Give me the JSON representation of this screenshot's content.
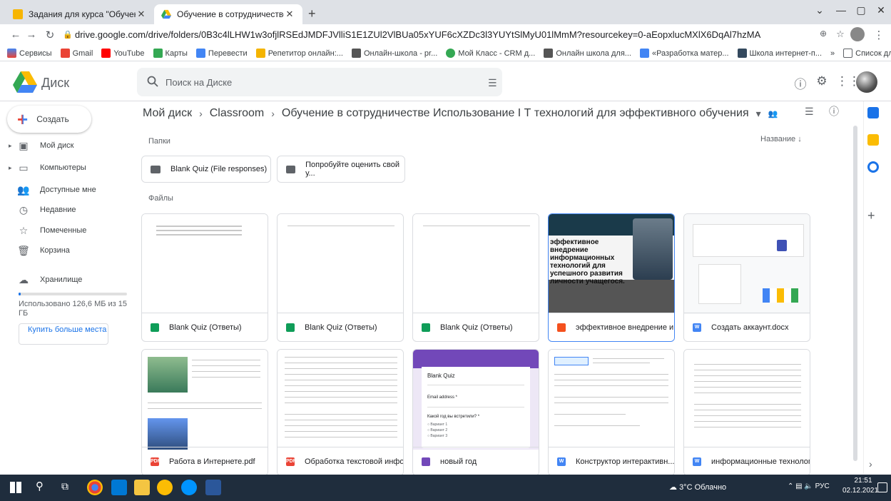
{
  "browser": {
    "tabs": [
      {
        "label": "Задания для курса \"Обучение и"
      },
      {
        "label": "Обучение в сотрудничестве Ис"
      }
    ],
    "url": "drive.google.com/drive/folders/0B3c4lLHW1w3ofjlRSEdJMDFJVlliS1E1ZUl2VlBUa05xYUF6cXZDc3l3YUYtSlMyU01lMmM?resourcekey=0-aEopxlucMXlX6DqAl7hzMA",
    "bookmarks": [
      "Сервисы",
      "Gmail",
      "YouTube",
      "Карты",
      "Перевести",
      "Репетитор онлайн:...",
      "Онлайн-школа - pr...",
      "Мой Класс - CRM д...",
      "Онлайн школа для...",
      "«Разработка матер...",
      "Школа интернет-п..."
    ],
    "reading_list": "Список для чтения"
  },
  "header": {
    "app_title": "Диск",
    "search_placeholder": "Поиск на Диске"
  },
  "sidebar": {
    "create_label": "Создать",
    "items": [
      {
        "label": "Мой диск",
        "icon": "drive-icon",
        "chev": "▸"
      },
      {
        "label": "Компьютеры",
        "icon": "computer-icon",
        "chev": "▸"
      },
      {
        "label": "Доступные мне",
        "icon": "shared-icon",
        "chev": ""
      },
      {
        "label": "Недавние",
        "icon": "clock-icon",
        "chev": ""
      },
      {
        "label": "Помеченные",
        "icon": "star-icon",
        "chev": ""
      },
      {
        "label": "Корзина",
        "icon": "trash-icon",
        "chev": ""
      }
    ],
    "storage_label": "Хранилище",
    "storage_used_text": "Использовано 126,6 МБ из 15 ГБ",
    "storage_used_fraction": 0.008,
    "buy_label": "Купить больше места"
  },
  "main": {
    "breadcrumb": [
      "Мой диск",
      "Classroom",
      "Обучение в сотрудничестве Использование I Т технологий для эффективного обучения"
    ],
    "folders_title": "Папки",
    "files_title": "Файлы",
    "sort_label": "Название",
    "folders": [
      {
        "label": "Blank Quiz (File responses)"
      },
      {
        "label": "Попробуйте оценить свой у..."
      }
    ],
    "files": [
      {
        "label": "Blank Quiz (Ответы)",
        "type": "sheet"
      },
      {
        "label": "Blank Quiz (Ответы)",
        "type": "sheet"
      },
      {
        "label": "Blank Quiz (Ответы)",
        "type": "sheet"
      },
      {
        "label": "эффективное внедрение и...",
        "type": "ppt"
      },
      {
        "label": "Создать аккаунт.docx",
        "type": "doc"
      },
      {
        "label": "Работа в Интернете.pdf",
        "type": "pdf"
      },
      {
        "label": "Обработка текстовой инфо...",
        "type": "pdf"
      },
      {
        "label": "новый год",
        "type": "form"
      },
      {
        "label": "Конструктор интерактивн...",
        "type": "doc"
      },
      {
        "label": "информационные технолог...",
        "type": "doc"
      }
    ],
    "ppt_thumb_text": "эффективное внедрение информационных технологий для успешного развития личности учащегося.",
    "form_thumb": {
      "title": "Blank Quiz",
      "field1": "Email address *",
      "field2": "Какой год вы встретили? *",
      "options": [
        "Вариант 1",
        "Вариант 2",
        "Вариант 3"
      ]
    }
  },
  "taskbar": {
    "weather": "3°C Облачно",
    "lang": "РУС",
    "time": "21:51",
    "date": "02.12.2021"
  },
  "colors": {
    "accent": "#1a73e8",
    "sheet": "#0f9d58",
    "pdf": "#ea4335",
    "doc": "#4285f4",
    "slides": "#f4511e",
    "form": "#7248b9"
  }
}
